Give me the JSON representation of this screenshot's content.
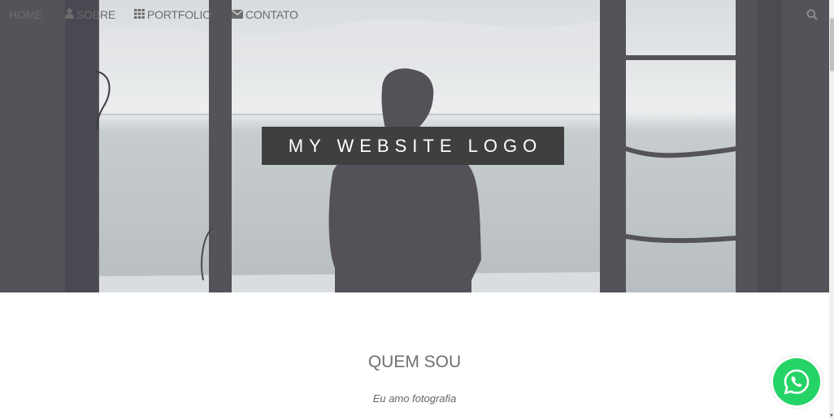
{
  "nav": {
    "items": [
      {
        "label": "HOME",
        "icon": ""
      },
      {
        "label": "SOBRE",
        "icon": "user-icon"
      },
      {
        "label": "PORTFOLIO",
        "icon": "grid-icon"
      },
      {
        "label": "CONTATO",
        "icon": "envelope-icon"
      }
    ],
    "search_icon": "search-icon"
  },
  "hero": {
    "logo_text": "MY WEBSITE LOGO"
  },
  "about": {
    "title": "QUEM SOU",
    "subtitle": "Eu amo fotografia"
  },
  "floating": {
    "icon": "whatsapp-icon",
    "color": "#25d366"
  },
  "colors": {
    "nav_text": "#6b6b6b",
    "logo_bg": "#3f3f3f",
    "frame": "#55535a"
  }
}
